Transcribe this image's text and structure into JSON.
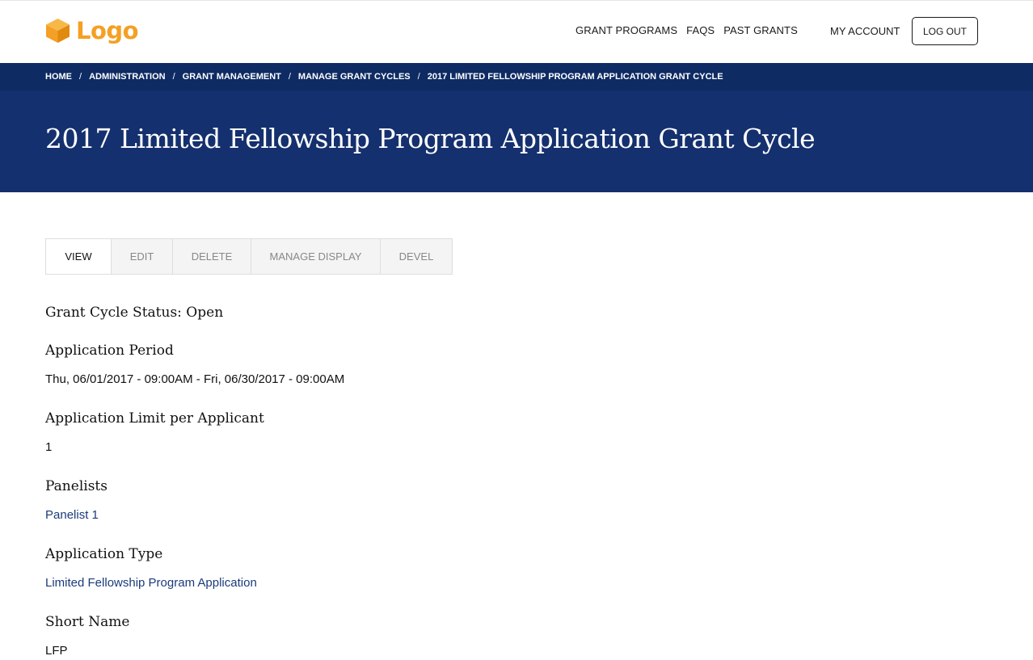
{
  "header": {
    "logo_text": "Logo",
    "logo_icon": "cube-icon",
    "brand_color": "#f4a024",
    "nav": [
      "GRANT PROGRAMS",
      "FAQS",
      "PAST GRANTS"
    ],
    "account": "MY ACCOUNT",
    "logout": "LOG OUT"
  },
  "breadcrumb": [
    "HOME",
    "ADMINISTRATION",
    "GRANT MANAGEMENT",
    "MANAGE GRANT CYCLES",
    "2017 LIMITED FELLOWSHIP PROGRAM APPLICATION GRANT CYCLE"
  ],
  "breadcrumb_separator": "/",
  "page": {
    "title": "2017 Limited Fellowship Program Application Grant Cycle",
    "hero_color": "#15306e",
    "breadcrumb_bar_color": "#0e2b63"
  },
  "tabs": [
    "VIEW",
    "EDIT",
    "DELETE",
    "MANAGE DISPLAY",
    "DEVEL"
  ],
  "active_tab": "VIEW",
  "content": {
    "status": "Grant Cycle Status: Open",
    "application_period_label": "Application Period",
    "application_period_value": "Thu, 06/01/2017 - 09:00AM - Fri, 06/30/2017 - 09:00AM",
    "limit_label": "Application Limit per Applicant",
    "limit_value": "1",
    "panelists_label": "Panelists",
    "panelists": [
      "Panelist 1"
    ],
    "application_type_label": "Application Type",
    "application_type_value": "Limited Fellowship Program Application",
    "short_name_label": "Short Name",
    "short_name_value": "LFP"
  }
}
